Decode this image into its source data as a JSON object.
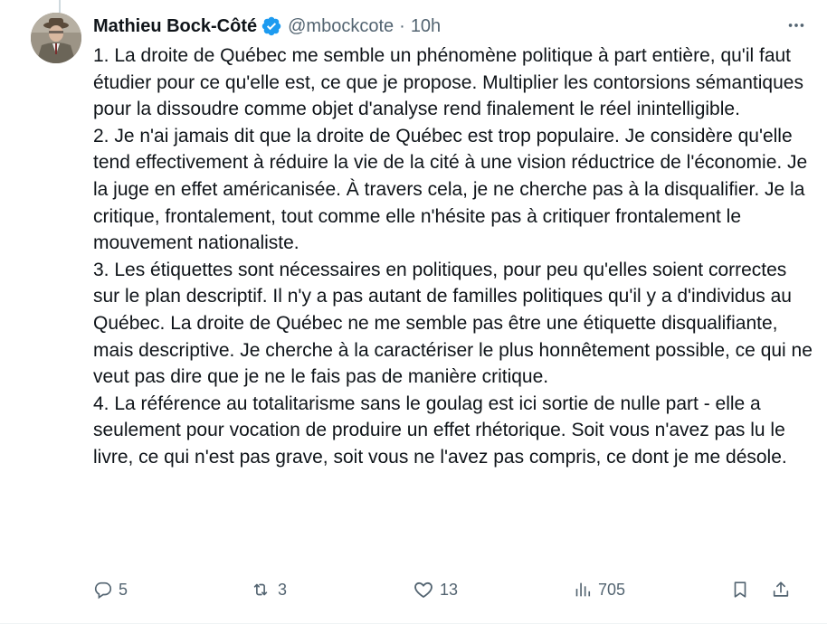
{
  "author": {
    "name": "Mathieu Bock-Côté",
    "handle": "@mbockcote",
    "separator": "·",
    "time": "10h"
  },
  "tweet": {
    "paragraphs": [
      "1. La droite de Québec me semble un phénomène politique à part entière, qu'il faut étudier pour ce qu'elle est, ce que je propose. Multiplier les contorsions sémantiques pour la dissoudre comme objet d'analyse rend finalement le réel inintelligible.",
      "2. Je n'ai jamais dit que la droite de Québec est trop populaire. Je considère qu'elle tend effectivement à réduire la vie de la cité à une vision réductrice de l'économie. Je la juge en effet américanisée. À travers cela, je ne cherche pas à la disqualifier. Je la critique, frontalement, tout comme elle n'hésite pas à critiquer frontalement le mouvement nationaliste.",
      "3. Les étiquettes sont nécessaires en politiques, pour peu qu'elles soient correctes sur le plan descriptif. Il n'y a pas autant de familles politiques qu'il y a d'individus au Québec. La droite de Québec ne me semble pas être une étiquette disqualifiante, mais descriptive. Je cherche à la caractériser le plus honnêtement possible, ce qui ne veut pas dire que je ne le fais pas de manière critique.",
      "4. La référence au totalitarisme sans le goulag est ici sortie de nulle part - elle a seulement pour vocation de produire un effet rhétorique. Soit vous n'avez pas lu le livre, ce qui n'est pas grave, soit vous ne l'avez pas compris, ce dont je me désole."
    ]
  },
  "actions": {
    "replies": "5",
    "reposts": "3",
    "likes": "13",
    "views": "705"
  },
  "icons": {
    "verified": "verified-badge-icon",
    "more": "more-icon",
    "reply": "reply-icon",
    "repost": "repost-icon",
    "like": "heart-icon",
    "views": "views-icon",
    "bookmark": "bookmark-icon",
    "share": "share-icon"
  },
  "colors": {
    "text": "#0f1419",
    "secondary": "#536471",
    "verified": "#1d9bf0"
  }
}
